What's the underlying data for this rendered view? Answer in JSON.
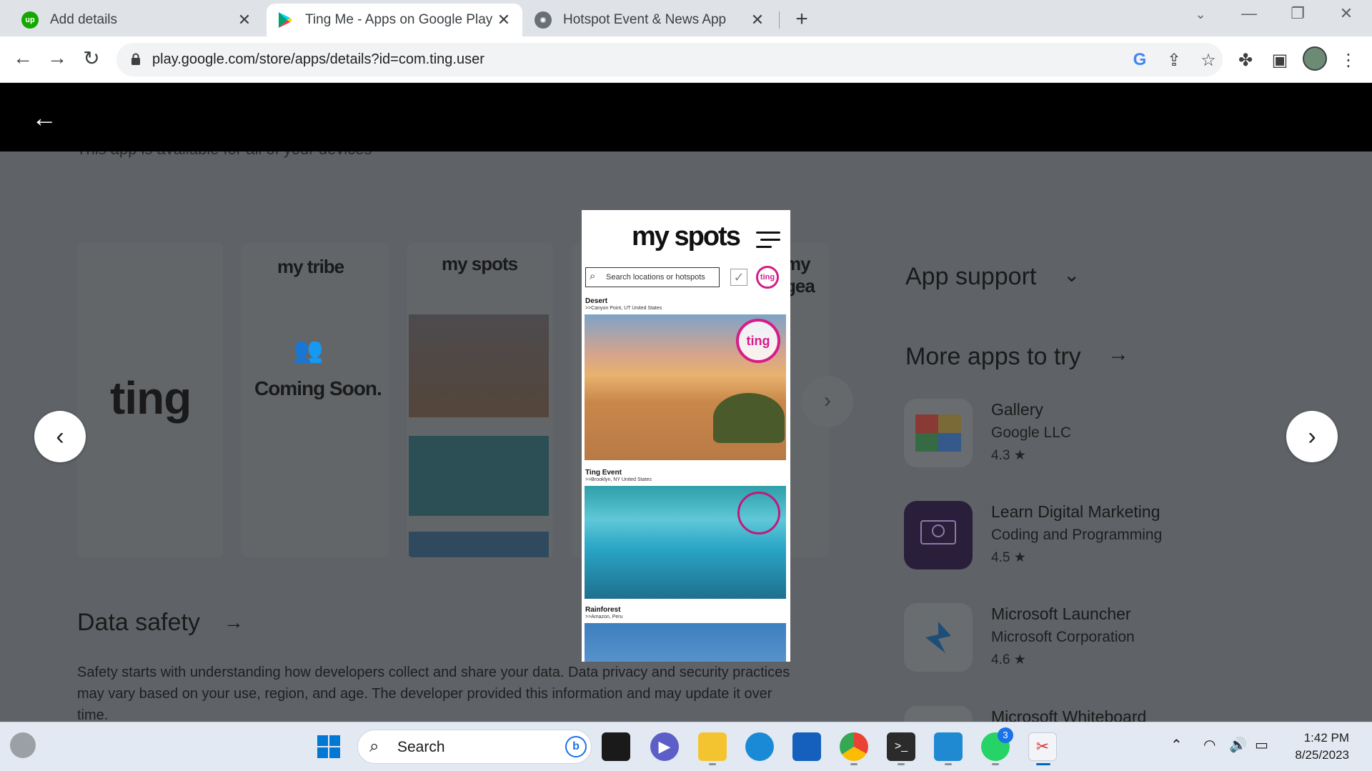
{
  "browser": {
    "tabs": [
      {
        "title": "Add details",
        "favicon": "upwork-icon",
        "active": false
      },
      {
        "title": "Ting Me - Apps on Google Play",
        "favicon": "google-play-icon",
        "active": true
      },
      {
        "title": "Hotspot Event & News App",
        "favicon": "chatgpt-icon",
        "active": false
      }
    ],
    "new_tab": "+",
    "url": "play.google.com/store/apps/details?id=com.ting.user",
    "window_controls": {
      "minimize": "—",
      "restore": "❐",
      "close": "✕"
    }
  },
  "viewer": {
    "back": "←"
  },
  "page": {
    "devices_line": "This app is available for all of your devices",
    "gallery_thumbs": {
      "ting_logo": "ting",
      "tribe_title": "my tribe",
      "coming_soon": "Coming Soon.",
      "spots_title": "my spots",
      "gear_title": "my gea"
    },
    "data_safety": {
      "title": "Data safety",
      "body": "Safety starts with understanding how developers collect and share your data. Data privacy and security practices may vary based on your use, region, and age. The developer provided this information and may update it over time."
    },
    "app_support": "App support",
    "more_apps": "More apps to try",
    "apps": [
      {
        "name": "Gallery",
        "developer": "Google LLC",
        "rating": "4.3 ★"
      },
      {
        "name": "Learn Digital Marketing",
        "developer": "Coding and Programming",
        "rating": "4.5 ★"
      },
      {
        "name": "Microsoft Launcher",
        "developer": "Microsoft Corporation",
        "rating": "4.6 ★"
      },
      {
        "name": "Microsoft Whiteboard",
        "developer": "",
        "rating": ""
      }
    ]
  },
  "featured_screenshot": {
    "title": "my spots",
    "search_placeholder": "Search locations or hotspots",
    "logo": "ting",
    "entries": [
      {
        "name": "Desert",
        "location": ">>Canyon Point, UT United States"
      },
      {
        "name": "Ting Event",
        "location": ">>Brooklyn, NY United States"
      },
      {
        "name": "Rainforest",
        "location": ">>Amazon, Peru"
      }
    ]
  },
  "taskbar": {
    "search_label": "Search",
    "whatsapp_badge": "3",
    "time": "1:42 PM",
    "date": "8/25/2023"
  }
}
